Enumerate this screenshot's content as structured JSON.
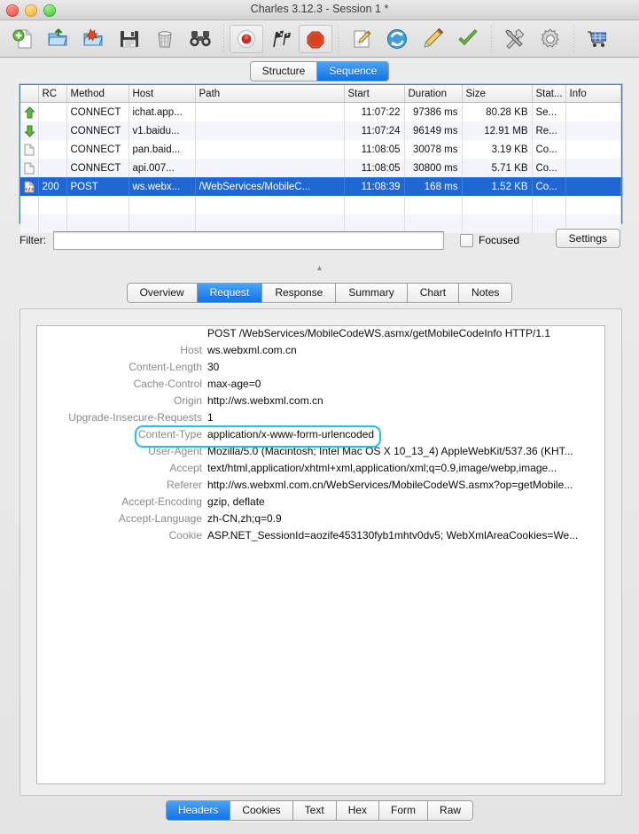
{
  "window": {
    "title": "Charles 3.12.3 - Session 1 *",
    "lights": [
      "close",
      "minimize",
      "zoom"
    ]
  },
  "toolbar": {
    "groups": [
      [
        {
          "name": "new-session-icon",
          "tip": "New Session"
        },
        {
          "name": "open-session-icon",
          "tip": "Open"
        },
        {
          "name": "import-session-icon",
          "tip": "Import"
        },
        {
          "name": "save-session-icon",
          "tip": "Save"
        },
        {
          "name": "clear-session-icon",
          "tip": "Clear"
        },
        {
          "name": "find-icon",
          "tip": "Find"
        }
      ],
      [
        {
          "name": "record-icon",
          "tip": "Start/Stop Recording"
        },
        {
          "name": "throttle-icon",
          "tip": "Throttling"
        },
        {
          "name": "breakpoints-icon",
          "tip": "Breakpoints"
        }
      ],
      [
        {
          "name": "compose-icon",
          "tip": "Compose"
        },
        {
          "name": "repeat-icon",
          "tip": "Repeat"
        },
        {
          "name": "edit-icon",
          "tip": "Edit"
        },
        {
          "name": "validate-icon",
          "tip": "Validate"
        }
      ],
      [
        {
          "name": "tools-icon",
          "tip": "Tools"
        },
        {
          "name": "settings-gear-icon",
          "tip": "Settings"
        }
      ],
      [
        {
          "name": "cart-icon",
          "tip": "Purchase"
        }
      ]
    ]
  },
  "view_toggle": {
    "options": [
      "Structure",
      "Sequence"
    ],
    "selected": "Sequence"
  },
  "session_table": {
    "columns": [
      "",
      "RC",
      "Method",
      "Host",
      "Path",
      "Start",
      "Duration",
      "Size",
      "Stat...",
      "Info"
    ],
    "rows": [
      {
        "gutter": "arrow-up-icon",
        "rc": "",
        "method": "CONNECT",
        "host": "ichat.app...",
        "path": "",
        "start": "11:07:22",
        "duration": "97386 ms",
        "size": "80.28 KB",
        "status": "Se...",
        "info": "",
        "selected": false
      },
      {
        "gutter": "arrow-down-icon",
        "rc": "",
        "method": "CONNECT",
        "host": "v1.baidu...",
        "path": "",
        "start": "11:07:24",
        "duration": "96149 ms",
        "size": "12.91 MB",
        "status": "Re...",
        "info": "",
        "selected": false
      },
      {
        "gutter": "page-icon",
        "rc": "",
        "method": "CONNECT",
        "host": "pan.baid...",
        "path": "",
        "start": "11:08:05",
        "duration": "30078 ms",
        "size": "3.19 KB",
        "status": "Co...",
        "info": "",
        "selected": false
      },
      {
        "gutter": "page-icon",
        "rc": "",
        "method": "CONNECT",
        "host": "api.007...",
        "path": "",
        "start": "11:08:05",
        "duration": "30800 ms",
        "size": "5.71 KB",
        "status": "Co...",
        "info": "",
        "selected": false
      },
      {
        "gutter": "page-code-icon",
        "rc": "200",
        "method": "POST",
        "host": "ws.webx...",
        "path": "/WebServices/MobileC...",
        "start": "11:08:39",
        "duration": "168 ms",
        "size": "1.52 KB",
        "status": "Co...",
        "info": "",
        "selected": true
      }
    ],
    "blank_rows": 2
  },
  "filter": {
    "label": "Filter:",
    "value": "",
    "placeholder": "",
    "focused_label": "Focused",
    "focused_checked": false,
    "settings_label": "Settings"
  },
  "detail_tabs": {
    "options": [
      "Overview",
      "Request",
      "Response",
      "Summary",
      "Chart",
      "Notes"
    ],
    "selected": "Request"
  },
  "request_headers": {
    "request_line": "POST  /WebServices/MobileCodeWS.asmx/getMobileCodeInfo HTTP/1.1",
    "rows": [
      {
        "key": "Host",
        "value": "ws.webxml.com.cn",
        "highlighted": false
      },
      {
        "key": "Content-Length",
        "value": "30",
        "highlighted": false
      },
      {
        "key": "Cache-Control",
        "value": "max-age=0",
        "highlighted": false
      },
      {
        "key": "Origin",
        "value": "http://ws.webxml.com.cn",
        "highlighted": false
      },
      {
        "key": "Upgrade-Insecure-Requests",
        "value": "1",
        "highlighted": false
      },
      {
        "key": "Content-Type",
        "value": "application/x-www-form-urlencoded",
        "highlighted": true
      },
      {
        "key": "User-Agent",
        "value": "Mozilla/5.0 (Macintosh; Intel Mac OS X 10_13_4) AppleWebKit/537.36 (KHT...",
        "highlighted": false
      },
      {
        "key": "Accept",
        "value": "text/html,application/xhtml+xml,application/xml;q=0.9,image/webp,image...",
        "highlighted": false
      },
      {
        "key": "Referer",
        "value": "http://ws.webxml.com.cn/WebServices/MobileCodeWS.asmx?op=getMobile...",
        "highlighted": false
      },
      {
        "key": "Accept-Encoding",
        "value": "gzip, deflate",
        "highlighted": false
      },
      {
        "key": "Accept-Language",
        "value": "zh-CN,zh;q=0.9",
        "highlighted": false
      },
      {
        "key": "Cookie",
        "value": "ASP.NET_SessionId=aozife453130fyb1mhtv0dv5; WebXmlAreaCookies=We...",
        "highlighted": false
      }
    ],
    "highlight_color": "#22c1ec"
  },
  "body_tabs": {
    "options": [
      "Headers",
      "Cookies",
      "Text",
      "Hex",
      "Form",
      "Raw"
    ],
    "selected": "Headers"
  },
  "collapse_chevron": "▴"
}
